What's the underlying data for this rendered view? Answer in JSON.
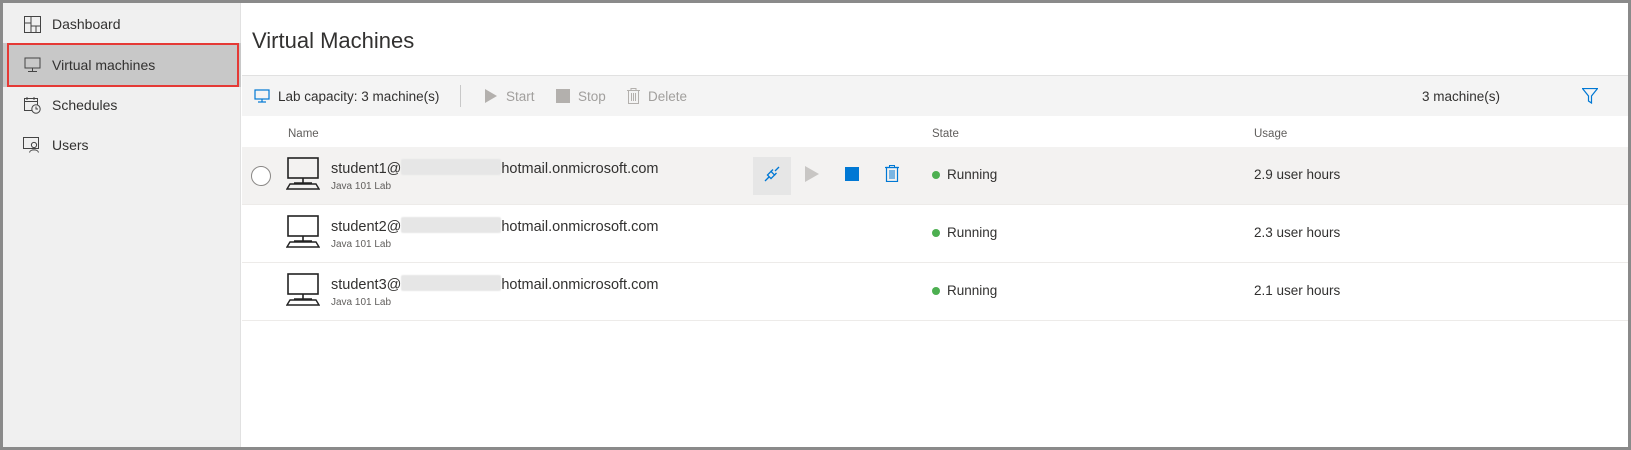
{
  "sidebar": {
    "items": [
      {
        "label": "Dashboard",
        "icon": "dashboard-icon"
      },
      {
        "label": "Virtual machines",
        "icon": "monitor-icon",
        "active": true
      },
      {
        "label": "Schedules",
        "icon": "calendar-clock-icon"
      },
      {
        "label": "Users",
        "icon": "user-icon"
      }
    ]
  },
  "main": {
    "title": "Virtual Machines",
    "toolbar": {
      "capacity_label": "Lab capacity: 3 machine(s)",
      "start_label": "Start",
      "stop_label": "Stop",
      "delete_label": "Delete",
      "count_label": "3 machine(s)"
    },
    "columns": {
      "name": "Name",
      "state": "State",
      "usage": "Usage"
    },
    "rows": [
      {
        "name_prefix": "student1@",
        "name_suffix": "hotmail.onmicrosoft.com",
        "lab": "Java 101 Lab",
        "state": "Running",
        "usage": "2.9 user hours"
      },
      {
        "name_prefix": "student2@",
        "name_suffix": "hotmail.onmicrosoft.com",
        "lab": "Java 101 Lab",
        "state": "Running",
        "usage": "2.3 user hours"
      },
      {
        "name_prefix": "student3@",
        "name_suffix": "hotmail.onmicrosoft.com",
        "lab": "Java 101 Lab",
        "state": "Running",
        "usage": "2.1 user hours"
      }
    ]
  },
  "colors": {
    "accent": "#0078d4",
    "running": "#4caf50",
    "highlight_border": "#e53935",
    "disabled": "#a19f9d"
  }
}
